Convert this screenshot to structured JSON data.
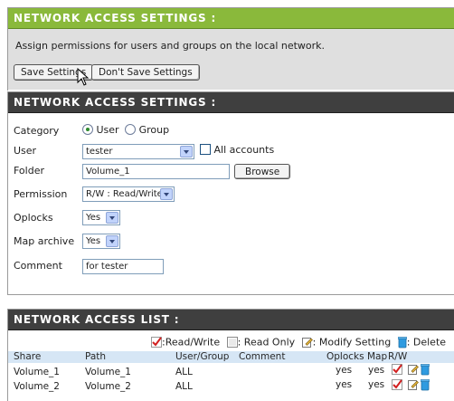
{
  "section_save": {
    "title": "NETWORK ACCESS SETTINGS :",
    "description": "Assign permissions for users and groups on the local network.",
    "save_label": "Save Settings",
    "dont_save_label": "Don't Save Settings"
  },
  "section_settings": {
    "title": "NETWORK ACCESS SETTINGS :",
    "category_label": "Category",
    "category_user": "User",
    "category_group": "Group",
    "user_label": "User",
    "user_value": "tester",
    "all_accounts_label": "All accounts",
    "folder_label": "Folder",
    "folder_value": "Volume_1",
    "browse_label": "Browse",
    "permission_label": "Permission",
    "permission_value": "R/W : Read/Write",
    "oplocks_label": "Oplocks",
    "oplocks_value": "Yes",
    "map_archive_label": "Map archive",
    "map_archive_value": "Yes",
    "comment_label": "Comment",
    "comment_value": "for tester"
  },
  "section_list": {
    "title": "NETWORK ACCESS LIST :",
    "legend": {
      "read_write": ":Read/Write",
      "read_only": ": Read Only",
      "modify": ": Modify Setting",
      "delete": ": Delete"
    },
    "columns": {
      "share": "Share",
      "path": "Path",
      "user_group": "User/Group",
      "comment": "Comment",
      "oplocks": "Oplocks",
      "map": "Map",
      "rw": "R/W"
    },
    "rows": [
      {
        "share": "Volume_1",
        "path": "Volume_1",
        "user_group": "ALL",
        "comment": "",
        "oplocks": "yes",
        "map": "yes"
      },
      {
        "share": "Volume_2",
        "path": "Volume_2",
        "user_group": "ALL",
        "comment": "",
        "oplocks": "yes",
        "map": "yes"
      }
    ]
  },
  "colors": {
    "header_green": "#8ab93b",
    "header_dark": "#3f3f3f",
    "table_header_bg": "#d6e6f5",
    "check_red": "#d22020"
  }
}
